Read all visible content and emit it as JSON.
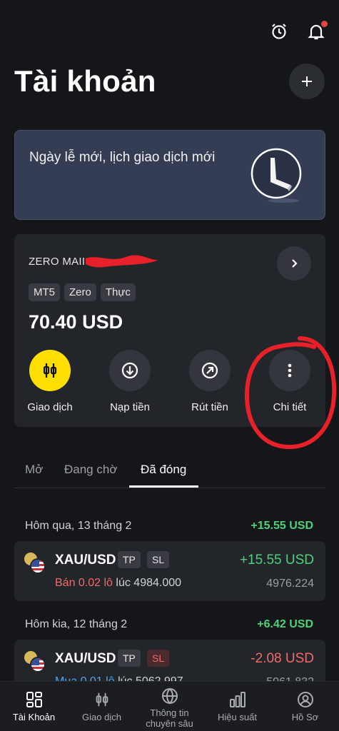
{
  "header": {
    "title": "Tài khoản",
    "alarm_icon": "alarm-clock-icon",
    "bell_icon": "bell-icon",
    "add_icon": "plus-icon"
  },
  "banner": {
    "text": "Ngày lễ mới, lịch giao dịch mới",
    "icon": "clock-icon"
  },
  "account": {
    "name": "ZERO MAII",
    "tags": [
      "MT5",
      "Zero",
      "Thực"
    ],
    "balance": "70.40 USD",
    "actions": [
      {
        "label": "Giao dịch",
        "icon": "candlestick-icon"
      },
      {
        "label": "Nạp tiền",
        "icon": "deposit-arrow-icon"
      },
      {
        "label": "Rút tiền",
        "icon": "withdraw-arrow-icon"
      },
      {
        "label": "Chi tiết",
        "icon": "more-vertical-icon"
      }
    ]
  },
  "tabs": [
    {
      "label": "Mở"
    },
    {
      "label": "Đang chờ"
    },
    {
      "label": "Đã đóng",
      "active": true
    }
  ],
  "groups": [
    {
      "date": "Hôm qua, 13 tháng 2",
      "total": "+15.55 USD",
      "positions": [
        {
          "symbol": "XAU/USD",
          "tp": "TP",
          "sl": "SL",
          "side": "Bán 0.02 lô",
          "at": "lúc 4984.000",
          "pnl": "+15.55 USD",
          "close_price": "4976.224"
        }
      ]
    },
    {
      "date": "Hôm kia, 12 tháng 2",
      "total": "+6.42 USD",
      "positions": [
        {
          "symbol": "XAU/USD",
          "tp": "TP",
          "sl": "SL",
          "side": "Mua 0.01 lô",
          "at": "lúc 5062.997",
          "pnl": "-2.08 USD",
          "close_price": "5061.832"
        }
      ]
    }
  ],
  "bottom_nav": [
    {
      "label": "Tài Khoản",
      "icon": "dashboard-grid-icon",
      "active": true
    },
    {
      "label": "Giao dịch",
      "icon": "candlestick-icon"
    },
    {
      "label": "Thông tin chuyên sâu",
      "icon": "globe-icon"
    },
    {
      "label": "Hiệu suất",
      "icon": "bar-chart-icon"
    },
    {
      "label": "Hồ Sơ",
      "icon": "profile-icon"
    }
  ],
  "colors": {
    "background": "#141619",
    "accent_yellow": "#ffde02",
    "profit_green": "#4fd17a",
    "loss_red": "#f26a6a",
    "buy_blue": "#4da3f0"
  }
}
